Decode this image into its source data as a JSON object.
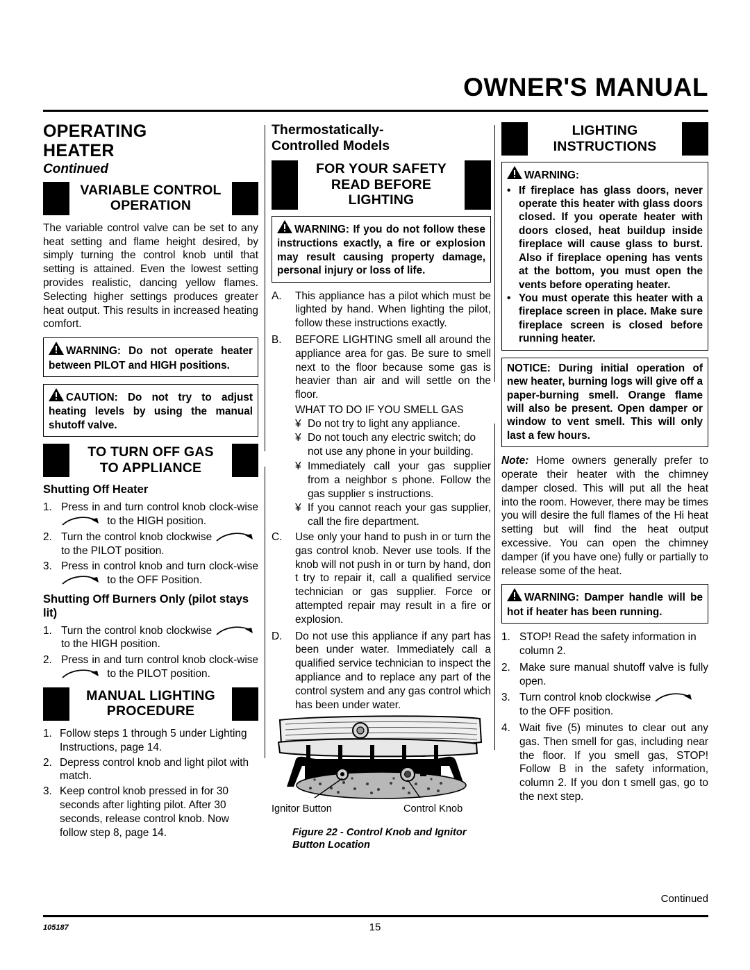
{
  "header": {
    "title": "OWNER'S MANUAL"
  },
  "col1": {
    "section_title_line1": "OPERATING",
    "section_title_line2": "HEATER",
    "section_continued": "Continued",
    "banner1_line1": "VARIABLE CONTROL",
    "banner1_line2": "OPERATION",
    "para1": "The variable control valve can be set to any heat setting and flame height desired, by simply turning the control knob until that setting is attained. Even the lowest setting provides realistic, dancing yellow flames. Selecting higher settings produces greater heat output. This results in increased heating comfort.",
    "warning1": "WARNING: Do not operate heater between PILOT and HIGH positions.",
    "caution1": "CAUTION: Do not try to adjust heating levels by using the manual shutoff valve.",
    "banner2_line1": "TO TURN OFF GAS",
    "banner2_line2": "TO APPLIANCE",
    "sub_h1": "Shutting Off Heater",
    "shut_heater": [
      {
        "n": "1.",
        "before": "Press in and turn control knob clock-wise",
        "after": "to the HIGH position."
      },
      {
        "n": "2.",
        "before": "Turn the control knob clockwise",
        "after": "to the PILOT position."
      },
      {
        "n": "3.",
        "before": "Press in control knob and turn clock-wise",
        "after": "to the OFF Position."
      }
    ],
    "sub_h2": "Shutting Off Burners Only (pilot stays lit)",
    "shut_burners": [
      {
        "n": "1.",
        "before": "Turn the control knob clockwise",
        "after": "to the HIGH position."
      },
      {
        "n": "2.",
        "before": "Press in and turn control knob clock-wise",
        "after": "to the PILOT position."
      }
    ],
    "banner3_line1": "MANUAL LIGHTING",
    "banner3_line2": "PROCEDURE",
    "manual_steps": [
      {
        "n": "1.",
        "t": "Follow steps 1 through 5 under Lighting Instructions, page 14."
      },
      {
        "n": "2.",
        "t": "Depress control knob and light pilot with match."
      },
      {
        "n": "3.",
        "t": "Keep control knob pressed in for 30 seconds after lighting pilot. After 30 seconds, release control knob. Now follow step 8, page 14."
      }
    ]
  },
  "col2": {
    "title_line1": "Thermostatically-",
    "title_line2": "Controlled Models",
    "banner_line1": "FOR YOUR SAFETY",
    "banner_line2": "READ BEFORE",
    "banner_line3": "LIGHTING",
    "warning": "WARNING: If you do not follow these instructions exactly, a fire or explosion may result causing property damage, personal injury or loss of life.",
    "items": [
      {
        "mk": "A.",
        "t": "This appliance has a pilot which must be lighted by hand. When lighting the pilot, follow these instructions exactly."
      },
      {
        "mk": "B.",
        "t": "BEFORE LIGHTING smell all around the appliance area for gas. Be sure to smell next to the floor because some gas is heavier than air and will settle on the floor."
      }
    ],
    "smell_heading": "WHAT TO DO IF YOU SMELL GAS",
    "bullet_mark": "¥",
    "smell_bullets": [
      "Do not try to light any appliance.",
      "Do not touch any electric switch; do not use any phone in your building.",
      "Immediately call your gas supplier from a neighbor s phone. Follow the gas supplier s instructions.",
      "If you cannot reach your gas supplier, call the fire department."
    ],
    "items2": [
      {
        "mk": "C.",
        "t": "Use only your hand to push in or turn the gas control knob. Never use tools. If the knob will not push in or turn by hand, don t try to repair it, call a qualified service technician or gas supplier. Force or attempted repair may result in a fire or explosion."
      },
      {
        "mk": "D.",
        "t": "Do not use this appliance if any part has been under water. Immediately call a qualified service technician to inspect the appliance and to replace any part of the control system and any gas control which has been under water."
      }
    ],
    "fig_label_left": "Ignitor Button",
    "fig_label_right": "Control Knob",
    "fig_caption": "Figure 22 - Control Knob and Ignitor Button Location"
  },
  "col3": {
    "banner_line1": "LIGHTING",
    "banner_line2": "INSTRUCTIONS",
    "warning_head": "WARNING:",
    "warning_bullets": [
      "If fireplace has glass doors, never operate this heater with glass doors closed. If you operate heater with doors closed, heat buildup inside fireplace will cause glass to burst. Also if fireplace opening has vents at the bottom, you must open the vents before operating heater.",
      "You must operate this heater with a fireplace screen in place. Make sure fireplace screen is closed before running heater."
    ],
    "notice": "NOTICE: During initial operation of new heater, burning logs will give off a paper-burning smell. Orange flame will also be present. Open damper or window to vent smell. This will only last a few hours.",
    "note_label": "Note:",
    "note_body": " Home owners generally prefer to operate their heater with the chimney damper closed. This will put all the heat into the room. However, there may be times you will desire the full flames of the Hi heat setting but will find the heat output excessive. You can open the chimney damper (if you have one) fully or partially to release some of the heat.",
    "warning2": "WARNING: Damper handle will be hot if heater has been running.",
    "steps": [
      {
        "n": "1.",
        "t": "STOP! Read the safety information in column 2."
      },
      {
        "n": "2.",
        "t": "Make sure manual shutoff valve is fully open."
      },
      {
        "n": "3.",
        "before": "Turn control knob clockwise",
        "after": "to the OFF position."
      },
      {
        "n": "4.",
        "t": "Wait five (5) minutes to clear out any gas. Then smell for gas, including near the floor. If you smell gas, STOP! Follow  B  in the safety information, column 2. If you don t smell gas, go to the next step."
      }
    ]
  },
  "footer": {
    "continued": "Continued",
    "part_number": "105187",
    "page_number": "15"
  },
  "colors": {
    "ink": "#000000",
    "paper": "#ffffff"
  }
}
